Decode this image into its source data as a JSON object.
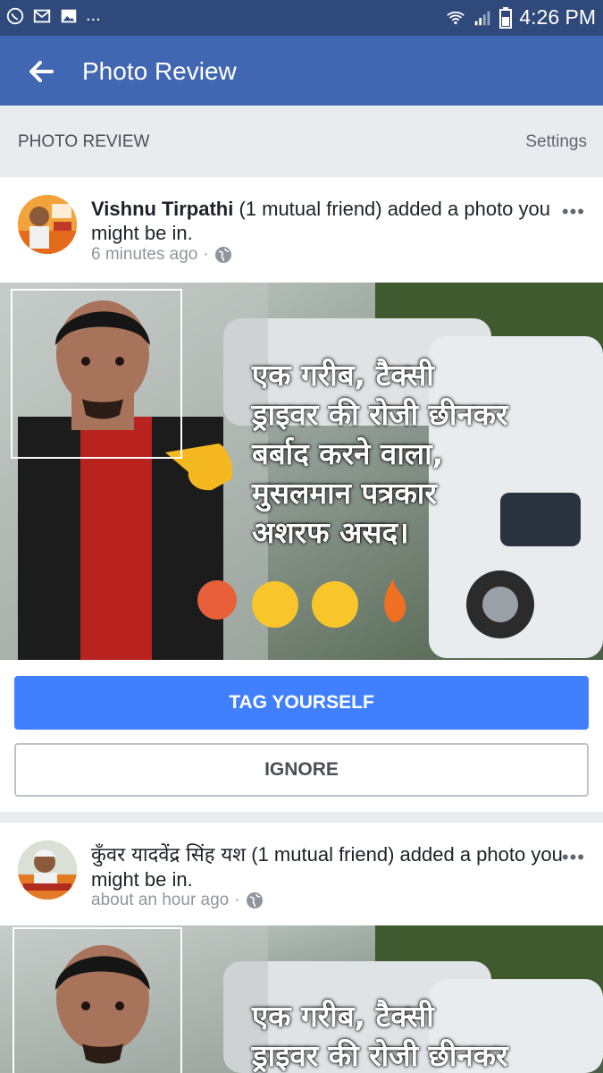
{
  "status_bar": {
    "left_icons": [
      "whatsapp-icon",
      "gmail-icon",
      "gallery-icon"
    ],
    "more": "...",
    "time": "4:26 PM"
  },
  "app_bar": {
    "title": "Photo Review"
  },
  "section": {
    "label": "PHOTO REVIEW",
    "settings": "Settings"
  },
  "posts": [
    {
      "author": "Vishnu Tirpathi",
      "text_rest": " (1 mutual friend) added a photo you might be in.",
      "time": "6 minutes ago",
      "dot": "·",
      "more": "•••",
      "photo": {
        "caption_lines": [
          "एक गरीब, टैक्सी",
          "ड्राइवर की रोजी छीनकर",
          "बर्बाद करने वाला,",
          "मुसलमान पत्रकार",
          "अशरफ असद।"
        ]
      },
      "tag_button": "TAG YOURSELF",
      "ignore_button": "IGNORE"
    },
    {
      "author": "कुँवर यादवेंद्र सिंह यश",
      "text_rest": " (1 mutual friend) added a photo you might be in.",
      "time": "about an hour ago",
      "dot": "·",
      "more": "•••",
      "photo": {
        "caption_lines": [
          "एक गरीब, टैक्सी",
          "ड्राइवर की रोजी छीनकर"
        ]
      }
    }
  ],
  "colors": {
    "app_bar": "#4267b2",
    "status_bar": "#2f4a7a",
    "primary_button": "#4080ff"
  }
}
